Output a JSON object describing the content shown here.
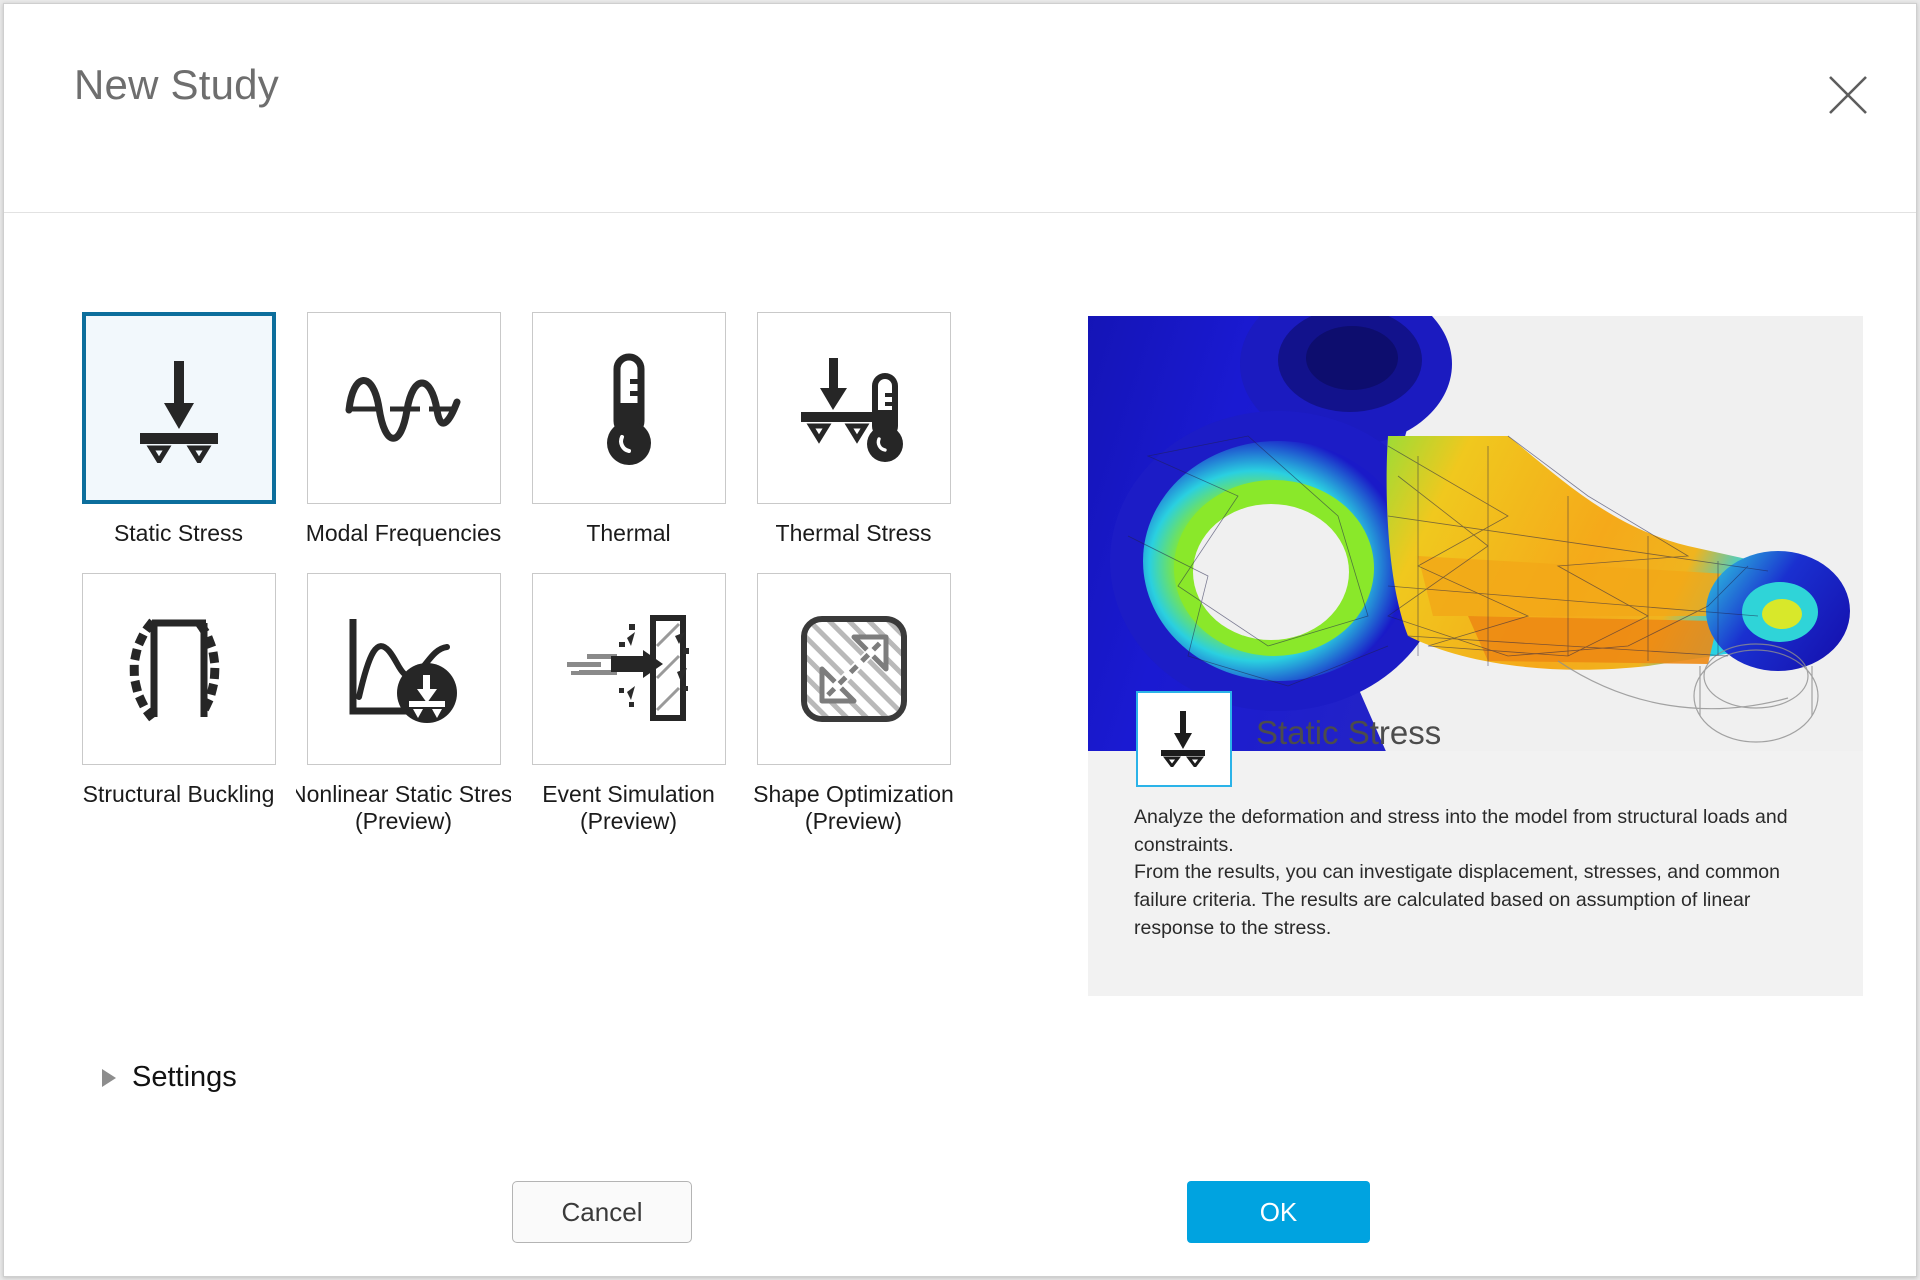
{
  "dialog": {
    "title": "New Study",
    "close_icon": "close-icon"
  },
  "study_types": {
    "rows": [
      [
        {
          "id": "static-stress",
          "label": "Static Stress",
          "sub": "",
          "icon": "beam-load-icon",
          "selected": true
        },
        {
          "id": "modal-frequencies",
          "label": "Modal Frequencies",
          "sub": "",
          "icon": "sine-wave-icon",
          "selected": false
        },
        {
          "id": "thermal",
          "label": "Thermal",
          "sub": "",
          "icon": "thermometer-icon",
          "selected": false
        },
        {
          "id": "thermal-stress",
          "label": "Thermal Stress",
          "sub": "",
          "icon": "beam-thermometer-icon",
          "selected": false
        }
      ],
      [
        {
          "id": "structural-buckling",
          "label": "Structural Buckling",
          "sub": "",
          "icon": "buckling-frame-icon",
          "selected": false
        },
        {
          "id": "nonlinear-static-stress",
          "label": "Nonlinear Static Stress",
          "sub": "(Preview)",
          "icon": "nonlinear-curve-icon",
          "selected": false
        },
        {
          "id": "event-simulation",
          "label": "Event Simulation",
          "sub": "(Preview)",
          "icon": "impact-icon",
          "selected": false
        },
        {
          "id": "shape-optimization",
          "label": "Shape Optimization",
          "sub": "(Preview)",
          "icon": "shape-optimization-icon",
          "selected": false
        }
      ]
    ]
  },
  "settings": {
    "label": "Settings",
    "disclosure_icon": "triangle-right-icon",
    "expanded": false
  },
  "preview": {
    "title": "Static Stress",
    "badge_icon": "beam-load-icon",
    "description_line1": "Analyze the deformation and stress into the model from structural loads and constraints.",
    "description_line2": "From the results, you can investigate displacement, stresses, and common failure criteria. The results are calculated based on assumption of linear response to the stress.",
    "image_alt": "fea-stress-result-steering-knuckle"
  },
  "footer": {
    "cancel_label": "Cancel",
    "ok_label": "OK"
  },
  "colors": {
    "selected_border": "#0c6e9c",
    "selected_fill": "#f2f8fc",
    "ok_button": "#00a3e0",
    "badge_border": "#2bb3e8",
    "title_text": "#6e6e6e"
  }
}
